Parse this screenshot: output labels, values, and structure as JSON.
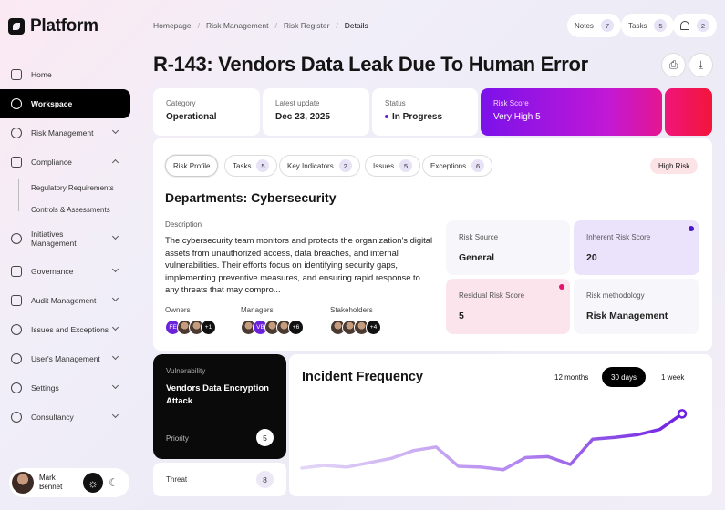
{
  "logo": {
    "text": "Platform"
  },
  "sidebar": {
    "items": [
      {
        "label": "Home"
      },
      {
        "label": "Workspace"
      },
      {
        "label": "Risk Management"
      },
      {
        "label": "Compliance"
      },
      {
        "label": "Initiatives\nManagement"
      },
      {
        "label": "Governance"
      },
      {
        "label": "Audit Management"
      },
      {
        "label": "Issues and Exceptions"
      },
      {
        "label": "User's Management"
      },
      {
        "label": "Settings"
      },
      {
        "label": "Consultancy"
      }
    ],
    "compliance_sub": [
      "Regulatory Requirements",
      "Controls & Assessments"
    ]
  },
  "user": {
    "name": "Mark\nBennet"
  },
  "breadcrumb": [
    "Homepage",
    "Risk Management",
    "Risk Register",
    "Details"
  ],
  "header": {
    "notes_label": "Notes",
    "notes_count": "7",
    "tasks_label": "Tasks",
    "tasks_count": "5",
    "alerts_count": "2"
  },
  "page": {
    "title": "R-143: Vendors Data Leak Due To Human Error"
  },
  "summary": {
    "category_label": "Category",
    "category": "Operational",
    "update_label": "Latest update",
    "update": "Dec 23, 2025",
    "status_label": "Status",
    "status": "In Progress",
    "risk_label": "Risk Score",
    "risk": "Very High 5"
  },
  "tabs": [
    {
      "label": "Risk Profile"
    },
    {
      "label": "Tasks",
      "count": "5"
    },
    {
      "label": "Key Indicators",
      "count": "2"
    },
    {
      "label": "Issues",
      "count": "5"
    },
    {
      "label": "Exceptions",
      "count": "6"
    }
  ],
  "badge": "High Risk",
  "department": "Departments: Cybersecurity",
  "description": {
    "label": "Description",
    "text": "The cybersecurity team monitors and protects the organization's digital assets from unauthorized access, data breaches, and internal vulnerabilities. Their efforts focus on identifying security gaps, implementing preventive measures, and ensuring rapid response to any threats that may compro..."
  },
  "people": {
    "owners_label": "Owners",
    "owners_initials": "FE",
    "owners_more": "+1",
    "managers_label": "Managers",
    "managers_initials": "VB",
    "managers_more": "+6",
    "stakeholders_label": "Stakeholders",
    "stakeholders_more": "+4"
  },
  "metrics": {
    "source_label": "Risk Source",
    "source": "General",
    "inherent_label": "Inherent Risk Score",
    "inherent": "20",
    "residual_label": "Residual Risk Score",
    "residual": "5",
    "method_label": "Risk methodology",
    "method": "Risk Management"
  },
  "vulnerability": {
    "label": "Vulnerability",
    "title": "Vendors Data Encryption Attack",
    "priority_label": "Priority",
    "priority": "5"
  },
  "threat": {
    "label": "Threat",
    "count": "8"
  },
  "incident": {
    "title": "Incident Frequency",
    "ranges": [
      "12 months",
      "30 days",
      "1 week"
    ],
    "selected": "30 days"
  },
  "chart_data": {
    "type": "line",
    "title": "Incident Frequency",
    "xlabel": "",
    "ylabel": "",
    "grid": false,
    "ylim": [
      0,
      10
    ],
    "x": [
      1,
      2,
      3,
      4,
      5,
      6,
      7,
      8,
      9,
      10,
      11,
      12,
      13,
      14,
      15,
      16,
      17,
      18
    ],
    "series": [
      {
        "values": [
          2.2,
          2.5,
          2.3,
          2.8,
          3.3,
          4.2,
          4.6,
          2.4,
          2.3,
          2.0,
          3.4,
          3.5,
          2.6,
          5.5,
          5.7,
          6.0,
          6.6,
          8.4
        ]
      }
    ],
    "colors": {
      "line_start": "#e4d8f6",
      "line_end": "#6d1fe0"
    }
  }
}
